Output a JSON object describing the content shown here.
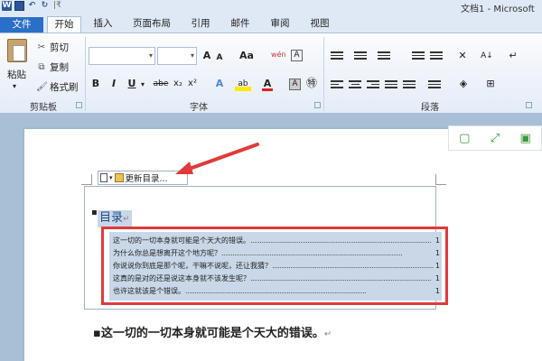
{
  "titlebar": {
    "title": "文档1 - Microsoft",
    "qat_sep": "|₹"
  },
  "icons": {
    "word": "W",
    "undo": "↶",
    "redo": "↻"
  },
  "tabs": [
    {
      "label": "文件"
    },
    {
      "label": "开始"
    },
    {
      "label": "插入"
    },
    {
      "label": "页面布局"
    },
    {
      "label": "引用"
    },
    {
      "label": "邮件"
    },
    {
      "label": "审阅"
    },
    {
      "label": "视图"
    }
  ],
  "clipboard": {
    "paste": "粘贴",
    "cut": "剪切",
    "copy": "复制",
    "format_painter": "格式刷",
    "group": "剪贴板"
  },
  "font": {
    "group": "字体",
    "grow": "A",
    "shrink": "A",
    "case": "Aa",
    "clear": "A",
    "bold": "B",
    "italic": "I",
    "underline": "U",
    "strike": "abe",
    "subscript": "x₂",
    "superscript": "x²",
    "effects": "A",
    "highlight": "ab",
    "color": "A",
    "char_shade": "A",
    "enclose": "㊕",
    "phonetic": "wén",
    "border": "A"
  },
  "paragraph": {
    "group": "段落",
    "sort": "A↓",
    "show_marks": "↵"
  },
  "toc_toolbar": {
    "update": "更新目录..."
  },
  "document": {
    "toc_heading": "目录",
    "toc_entries": [
      {
        "text": "这一切的一切本身就可能是个天大的错误。",
        "page": "1"
      },
      {
        "text": "为什么你总是想离开这个地方呢？",
        "page": "1"
      },
      {
        "text": "你说说你到底是那个呢，干嘛不说呢，还让我猜？",
        "page": "1"
      },
      {
        "text": "这真的是对的还是说这本身就不该发生呢？",
        "page": "1"
      },
      {
        "text": "也许这就该是个错误。",
        "page": "1"
      }
    ],
    "body_text": "这一切的一切本身就可能是个天大的错误。",
    "para_mark": "↵"
  },
  "side_tools": {
    "a": "▢",
    "b": "⤢",
    "c": "▣"
  }
}
